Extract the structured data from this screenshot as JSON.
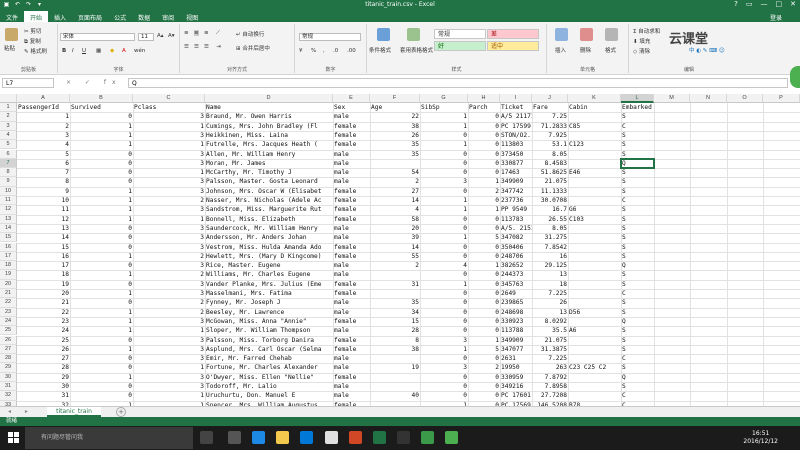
{
  "window": {
    "title": "titanic_train.csv - Excel",
    "login": "登录"
  },
  "ribbon_tabs": [
    "文件",
    "开始",
    "插入",
    "页面布局",
    "公式",
    "数据",
    "审阅",
    "视图"
  ],
  "ribbon": {
    "paste": "粘贴",
    "cut": "剪切",
    "copy": "复制",
    "format_painter": "格式刷",
    "clipboard_group": "剪贴板",
    "font_name": "宋体",
    "font_size": "11",
    "font_group": "字体",
    "wrap_text": "自动换行",
    "merge_center": "合并后居中",
    "alignment_group": "对齐方式",
    "number_format": "常规",
    "number_group": "数字",
    "conditional_format": "条件格式",
    "table_format": "套用表格格式",
    "style_normal": "常规",
    "style_bad": "差",
    "style_good": "好",
    "style_neutral": "适中",
    "styles_group": "样式",
    "insert": "插入",
    "delete": "删除",
    "format": "格式",
    "cells_group": "单元格",
    "autosum": "自动求和",
    "fill": "填充",
    "clear": "清除",
    "editing_group": "编辑",
    "overlay_text": "云课堂"
  },
  "formula_bar": {
    "name_box": "L7",
    "fx_icons": "× ✓ fx",
    "content": "Q"
  },
  "columns": {
    "letters": [
      "A",
      "B",
      "C",
      "D",
      "E",
      "F",
      "G",
      "H",
      "I",
      "J",
      "K",
      "L",
      "M",
      "N",
      "O",
      "P"
    ],
    "active": "L"
  },
  "rows": [
    [
      "PassengerId",
      "Survived",
      "Pclass",
      "Name",
      "Sex",
      "Age",
      "SibSp",
      "Parch",
      "Ticket",
      "Fare",
      "Cabin",
      "Embarked"
    ],
    [
      "1",
      "0",
      "3",
      "Braund, Mr. Owen Harris",
      "male",
      "22",
      "1",
      "0",
      "A/5 21171",
      "7.25",
      "",
      "S"
    ],
    [
      "2",
      "1",
      "1",
      "Cumings, Mrs. John Bradley (Fl",
      "female",
      "38",
      "1",
      "0",
      "PC 17599",
      "71.2833",
      "C85",
      "C"
    ],
    [
      "3",
      "1",
      "3",
      "Heikkinen, Miss. Laina",
      "female",
      "26",
      "0",
      "0",
      "STON/O2.",
      "7.925",
      "",
      "S"
    ],
    [
      "4",
      "1",
      "1",
      "Futrelle, Mrs. Jacques Heath (",
      "female",
      "35",
      "1",
      "0",
      "113803",
      "53.1",
      "C123",
      "S"
    ],
    [
      "5",
      "0",
      "3",
      "Allen, Mr. William Henry",
      "male",
      "35",
      "0",
      "0",
      "373450",
      "8.05",
      "",
      "S"
    ],
    [
      "6",
      "0",
      "3",
      "Moran, Mr. James",
      "male",
      "",
      "0",
      "0",
      "330877",
      "8.4583",
      "",
      "Q"
    ],
    [
      "7",
      "0",
      "1",
      "McCarthy, Mr. Timothy J",
      "male",
      "54",
      "0",
      "0",
      "17463",
      "51.8625",
      "E46",
      "S"
    ],
    [
      "8",
      "0",
      "3",
      "Palsson, Master. Gosta Leonard",
      "male",
      "2",
      "3",
      "1",
      "349909",
      "21.075",
      "",
      "S"
    ],
    [
      "9",
      "1",
      "3",
      "Johnson, Mrs. Oscar W (Elisabet",
      "female",
      "27",
      "0",
      "2",
      "347742",
      "11.1333",
      "",
      "S"
    ],
    [
      "10",
      "1",
      "2",
      "Nasser, Mrs. Nicholas (Adele Ac",
      "female",
      "14",
      "1",
      "0",
      "237736",
      "30.0708",
      "",
      "C"
    ],
    [
      "11",
      "1",
      "3",
      "Sandstrom, Miss. Marguerite Rut",
      "female",
      "4",
      "1",
      "1",
      "PP 9549",
      "16.7",
      "G6",
      "S"
    ],
    [
      "12",
      "1",
      "1",
      "Bonnell, Miss. Elizabeth",
      "female",
      "58",
      "0",
      "0",
      "113783",
      "26.55",
      "C103",
      "S"
    ],
    [
      "13",
      "0",
      "3",
      "Saundercock, Mr. William Henry",
      "male",
      "20",
      "0",
      "0",
      "A/5. 2151",
      "8.05",
      "",
      "S"
    ],
    [
      "14",
      "0",
      "3",
      "Andersson, Mr. Anders Johan",
      "male",
      "39",
      "1",
      "5",
      "347082",
      "31.275",
      "",
      "S"
    ],
    [
      "15",
      "0",
      "3",
      "Vestrom, Miss. Hulda Amanda Ado",
      "female",
      "14",
      "0",
      "0",
      "350406",
      "7.8542",
      "",
      "S"
    ],
    [
      "16",
      "1",
      "2",
      "Hewlett, Mrs. (Mary D Kingcome)",
      "female",
      "55",
      "0",
      "0",
      "248706",
      "16",
      "",
      "S"
    ],
    [
      "17",
      "0",
      "3",
      "Rice, Master. Eugene",
      "male",
      "2",
      "4",
      "1",
      "382652",
      "29.125",
      "",
      "Q"
    ],
    [
      "18",
      "1",
      "2",
      "Williams, Mr. Charles Eugene",
      "male",
      "",
      "0",
      "0",
      "244373",
      "13",
      "",
      "S"
    ],
    [
      "19",
      "0",
      "3",
      "Vander Planke, Mrs. Julius (Eme",
      "female",
      "31",
      "1",
      "0",
      "345763",
      "18",
      "",
      "S"
    ],
    [
      "20",
      "1",
      "3",
      "Masselmani, Mrs. Fatima",
      "female",
      "",
      "0",
      "0",
      "2649",
      "7.225",
      "",
      "C"
    ],
    [
      "21",
      "0",
      "2",
      "Fynney, Mr. Joseph J",
      "male",
      "35",
      "0",
      "0",
      "239865",
      "26",
      "",
      "S"
    ],
    [
      "22",
      "1",
      "2",
      "Beesley, Mr. Lawrence",
      "male",
      "34",
      "0",
      "0",
      "248698",
      "13",
      "D56",
      "S"
    ],
    [
      "23",
      "1",
      "3",
      "McGowan, Miss. Anna \"Annie\"",
      "female",
      "15",
      "0",
      "0",
      "330923",
      "8.0292",
      "",
      "Q"
    ],
    [
      "24",
      "1",
      "1",
      "Sloper, Mr. William Thompson",
      "male",
      "28",
      "0",
      "0",
      "113788",
      "35.5",
      "A6",
      "S"
    ],
    [
      "25",
      "0",
      "3",
      "Palsson, Miss. Torborg Danira",
      "female",
      "8",
      "3",
      "1",
      "349909",
      "21.075",
      "",
      "S"
    ],
    [
      "26",
      "1",
      "3",
      "Asplund, Mrs. Carl Oscar (Selma",
      "female",
      "38",
      "1",
      "5",
      "347077",
      "31.3875",
      "",
      "S"
    ],
    [
      "27",
      "0",
      "3",
      "Emir, Mr. Farred Chehab",
      "male",
      "",
      "0",
      "0",
      "2631",
      "7.225",
      "",
      "C"
    ],
    [
      "28",
      "0",
      "1",
      "Fortune, Mr. Charles Alexander",
      "male",
      "19",
      "3",
      "2",
      "19950",
      "263",
      "C23 C25 C2",
      "S"
    ],
    [
      "29",
      "1",
      "3",
      "O'Dwyer, Miss. Ellen \"Nellie\"",
      "female",
      "",
      "0",
      "0",
      "330959",
      "7.8792",
      "",
      "Q"
    ],
    [
      "30",
      "0",
      "3",
      "Todoroff, Mr. Lalio",
      "male",
      "",
      "0",
      "0",
      "349216",
      "7.8958",
      "",
      "S"
    ],
    [
      "31",
      "0",
      "1",
      "Uruchurtu, Don. Manuel E",
      "male",
      "40",
      "0",
      "0",
      "PC 17601",
      "27.7208",
      "",
      "C"
    ],
    [
      "32",
      "1",
      "1",
      "Spencer, Mrs. William Augustus",
      "female",
      "",
      "1",
      "0",
      "PC 17569",
      "146.5208",
      "B78",
      "C"
    ]
  ],
  "sheet": {
    "tab": "titanic_train",
    "status": "就绪"
  },
  "taskbar": {
    "search": "有问题尽管问我",
    "time": "16:51",
    "date": "2016/12/12"
  }
}
